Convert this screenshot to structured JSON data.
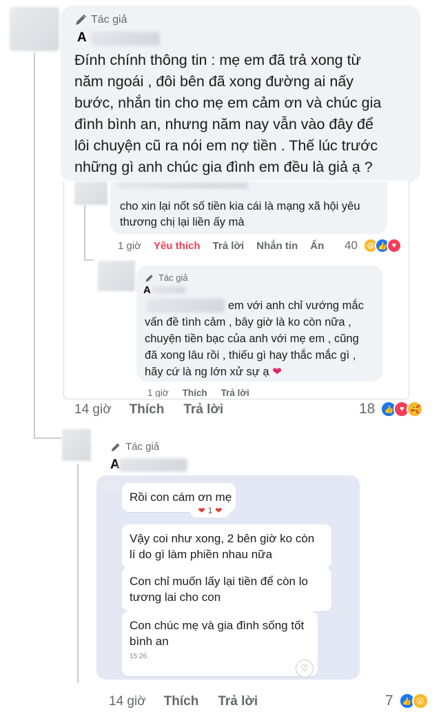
{
  "main_comment": {
    "author_tag": "Tác giả",
    "author_initial": "A",
    "text_lines": [
      "Đính chính thông tin : mẹ em đã trả xong từ",
      "năm ngoái , đôi bên đã xong đường ai nấy",
      "bước, nhắn tin cho mẹ em cảm ơn và chúc gia",
      "đình bình an, nhưng năm nay vẫn vào đây để",
      "lôi chuyện cũ ra nói em nợ tiền . Thế lúc trước",
      "những gì anh chúc gia đình em đều là giả ạ ?"
    ],
    "time": "14 giờ",
    "like": "Thích",
    "reply": "Trả lời",
    "reaction_count": "18"
  },
  "embedded_reply": {
    "text_lines": [
      "cho xin lại nốt số tiền kia cái là mạng xã hội yêu",
      "thương chị lại liền ấy mà"
    ],
    "time": "1 giờ",
    "liked": "Yêu thích",
    "reply": "Trả lời",
    "message": "Nhắn tin",
    "hide": "Ẩn",
    "reaction_count": "40"
  },
  "embedded_author_reply": {
    "author_tag": "Tác giả",
    "author_initial": "A",
    "text_lines": [
      "em với anh chỉ vướng mắc",
      "vấn đề tình cảm , bây giờ là ko còn nữa ,",
      "chuyện tiền bạc của anh với mẹ em , cũng",
      "đã xong lâu rồi , thiếu gì hay thắc mắc gì ,",
      "hãy cứ là ng lớn xử sự ạ"
    ],
    "heart_emoji": "❤️",
    "time": "1 giờ",
    "like": "Thích",
    "reply": "Trả lời"
  },
  "second_comment": {
    "author_tag": "Tác giả",
    "author_initial": "A",
    "chat_messages": [
      "Rồi con cám ơn mẹ",
      "Vậy coi như xong, 2 bên giờ ko còn lí do gì làm phiền nhau nữa",
      "Con chỉ muốn lấy lại tiền để còn lo tương lai cho con",
      "Con chúc mẹ và gia đình sống tốt bình an"
    ],
    "chat_msg1_lines": [
      "Rồi con cám ơn mẹ"
    ],
    "chat_msg2_lines": [
      "Vậy coi như xong, 2 bên giờ ko còn",
      "lí do gì làm phiền nhau nữa"
    ],
    "chat_msg3_lines": [
      "Con chỉ muốn lấy lại tiền để còn lo",
      "tương lai cho con"
    ],
    "chat_msg4_lines": [
      "Con chúc mẹ và gia đình sống tốt",
      "bình an"
    ],
    "chat_heart_count": "1",
    "chat_timestamp": "15:26",
    "time": "14 giờ",
    "like": "Thích",
    "reply": "Trả lời",
    "reaction_count": "7"
  },
  "colors": {
    "bubble": "#f0f2f5",
    "chat_background": "#e4e7f4",
    "meta": "#65676b",
    "love": "#f33e58",
    "like": "#1877f2",
    "haha": "#f7b928"
  }
}
